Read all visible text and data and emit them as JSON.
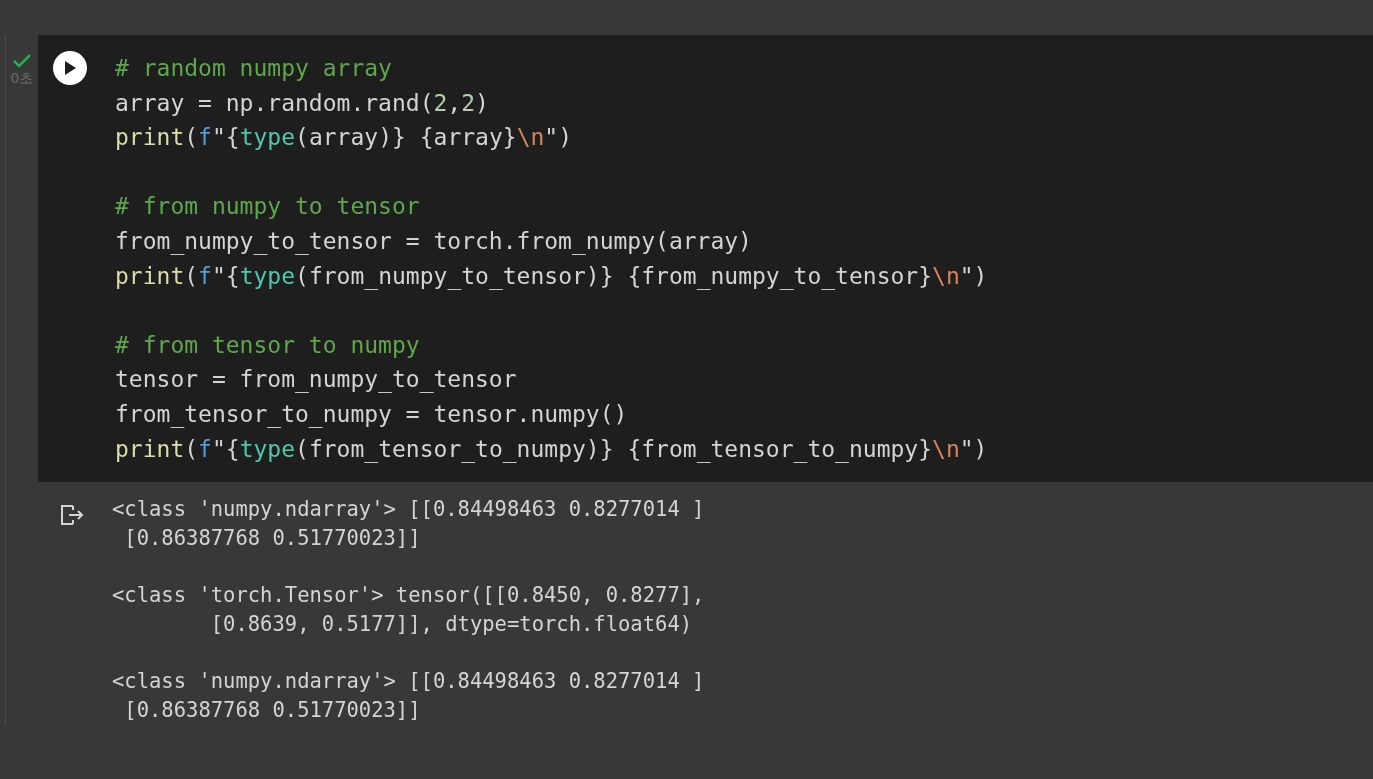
{
  "cell": {
    "succeeded": true,
    "duration": "0초",
    "code": [
      [
        [
          {
            "kind": "comment",
            "text": "# random numpy array"
          }
        ],
        [
          {
            "kind": "plain",
            "text": "array = np.random.rand("
          },
          {
            "kind": "number",
            "text": "2"
          },
          {
            "kind": "plain",
            "text": ","
          },
          {
            "kind": "number",
            "text": "2"
          },
          {
            "kind": "plain",
            "text": ")"
          }
        ],
        [
          {
            "kind": "func",
            "text": "print"
          },
          {
            "kind": "plain",
            "text": "("
          },
          {
            "kind": "keyword",
            "text": "f"
          },
          {
            "kind": "plain",
            "text": "\"{"
          },
          {
            "kind": "builtin",
            "text": "type"
          },
          {
            "kind": "plain",
            "text": "(array)} {array}"
          },
          {
            "kind": "escape",
            "text": "\\n"
          },
          {
            "kind": "plain",
            "text": "\")"
          }
        ]
      ],
      [
        [
          {
            "kind": "comment",
            "text": "# from numpy to tensor"
          }
        ],
        [
          {
            "kind": "plain",
            "text": "from_numpy_to_tensor = torch.from_numpy(array)"
          }
        ],
        [
          {
            "kind": "func",
            "text": "print"
          },
          {
            "kind": "plain",
            "text": "("
          },
          {
            "kind": "keyword",
            "text": "f"
          },
          {
            "kind": "plain",
            "text": "\"{"
          },
          {
            "kind": "builtin",
            "text": "type"
          },
          {
            "kind": "plain",
            "text": "(from_numpy_to_tensor)} {from_numpy_to_tensor}"
          },
          {
            "kind": "escape",
            "text": "\\n"
          },
          {
            "kind": "plain",
            "text": "\")"
          }
        ]
      ],
      [
        [
          {
            "kind": "comment",
            "text": "# from tensor to numpy"
          }
        ],
        [
          {
            "kind": "plain",
            "text": "tensor = from_numpy_to_tensor"
          }
        ],
        [
          {
            "kind": "plain",
            "text": "from_tensor_to_numpy = tensor.numpy()"
          }
        ],
        [
          {
            "kind": "func",
            "text": "print"
          },
          {
            "kind": "plain",
            "text": "("
          },
          {
            "kind": "keyword",
            "text": "f"
          },
          {
            "kind": "plain",
            "text": "\"{"
          },
          {
            "kind": "builtin",
            "text": "type"
          },
          {
            "kind": "plain",
            "text": "(from_tensor_to_numpy)} {from_tensor_to_numpy}"
          },
          {
            "kind": "escape",
            "text": "\\n"
          },
          {
            "kind": "plain",
            "text": "\")"
          }
        ]
      ]
    ],
    "output": [
      [
        "<class 'numpy.ndarray'> [[0.84498463 0.8277014 ]",
        " [0.86387768 0.51770023]]"
      ],
      [
        "<class 'torch.Tensor'> tensor([[0.8450, 0.8277],",
        "        [0.8639, 0.5177]], dtype=torch.float64)"
      ],
      [
        "<class 'numpy.ndarray'> [[0.84498463 0.8277014 ]",
        " [0.86387768 0.51770023]]"
      ]
    ]
  }
}
